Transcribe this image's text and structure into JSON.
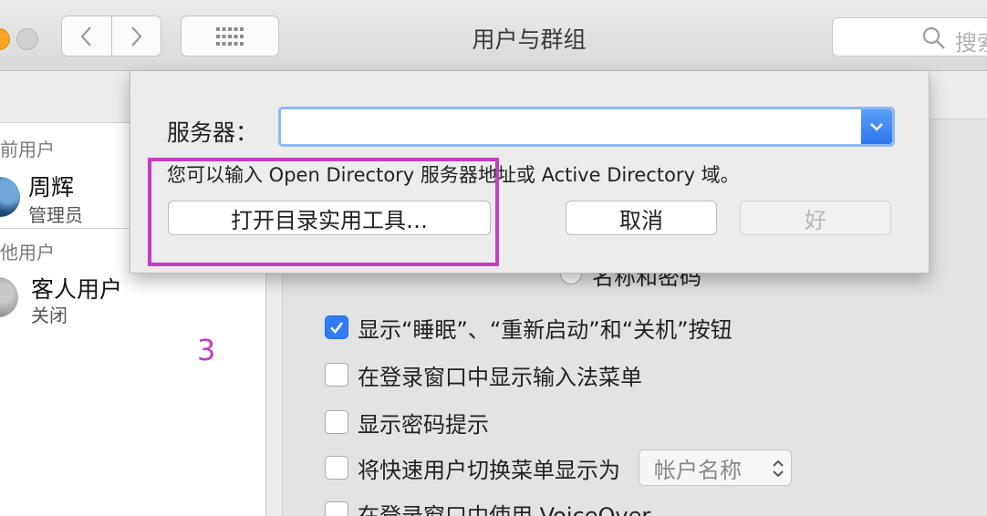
{
  "window": {
    "title": "用户与群组",
    "search_placeholder": "搜索"
  },
  "sidebar": {
    "current_users_label": "前用户",
    "other_users_label": "他用户",
    "users": [
      {
        "name": "周辉",
        "role": "管理员"
      },
      {
        "name": "客人用户",
        "role": "关闭"
      }
    ]
  },
  "annotation": {
    "number": "3"
  },
  "content": {
    "radio_peek_label": "名称和密码",
    "options": [
      {
        "label": "显示“睡眠”、“重新启动”和“关机”按钮",
        "checked": true
      },
      {
        "label": "在登录窗口中显示输入法菜单",
        "checked": false
      },
      {
        "label": "显示密码提示",
        "checked": false
      },
      {
        "label": "将快速用户切换菜单显示为",
        "checked": false
      },
      {
        "label": "在登录窗口中使用 VoiceOver",
        "checked": false
      }
    ],
    "fast_switch_popup": "帐户名称"
  },
  "dialog": {
    "server_label": "服务器：",
    "server_value": "",
    "hint": "您可以输入 Open Directory 服务器地址或 Active Directory 域。",
    "open_utility_button": "打开目录实用工具…",
    "cancel_button": "取消",
    "ok_button": "好"
  },
  "colors": {
    "accent": "#2f7cf6",
    "highlight": "#c43dc4"
  }
}
